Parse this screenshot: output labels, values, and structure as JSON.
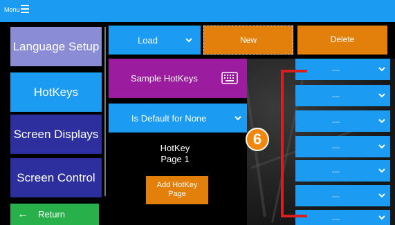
{
  "topbar": {
    "menu_label": "Menu"
  },
  "sidebar": {
    "items": [
      {
        "label": "Language Setup"
      },
      {
        "label": "HotKeys"
      },
      {
        "label": "Screen Displays"
      },
      {
        "label": "Screen Control"
      }
    ],
    "return_label": "Return"
  },
  "toolbar": {
    "load_label": "Load",
    "new_label": "New",
    "delete_label": "Delete"
  },
  "hotkey_set": {
    "name": "Sample HotKeys"
  },
  "default_select": {
    "value": "Is Default for None"
  },
  "page": {
    "line1": "HotKey",
    "line2": "Page 1",
    "add_line1": "Add HotKey",
    "add_line2": "Page"
  },
  "hotkey_slots": [
    {
      "value": "---"
    },
    {
      "value": "---"
    },
    {
      "value": "---"
    },
    {
      "value": "---"
    },
    {
      "value": "---"
    },
    {
      "value": "---"
    },
    {
      "value": "---"
    }
  ],
  "callout": {
    "number": "6"
  },
  "colors": {
    "topbar": "#1b9cf2",
    "accent_blue": "#1b9cf2",
    "orange": "#e37f0b",
    "purple": "#9b1c9e",
    "lavender": "#8a8cd6",
    "navy": "#2e2f9e",
    "green": "#28b04a",
    "callout_red": "#d81e1e"
  },
  "icons": [
    "menu-icon",
    "arrow-left-icon",
    "chevron-down-icon",
    "keyboard-icon"
  ]
}
